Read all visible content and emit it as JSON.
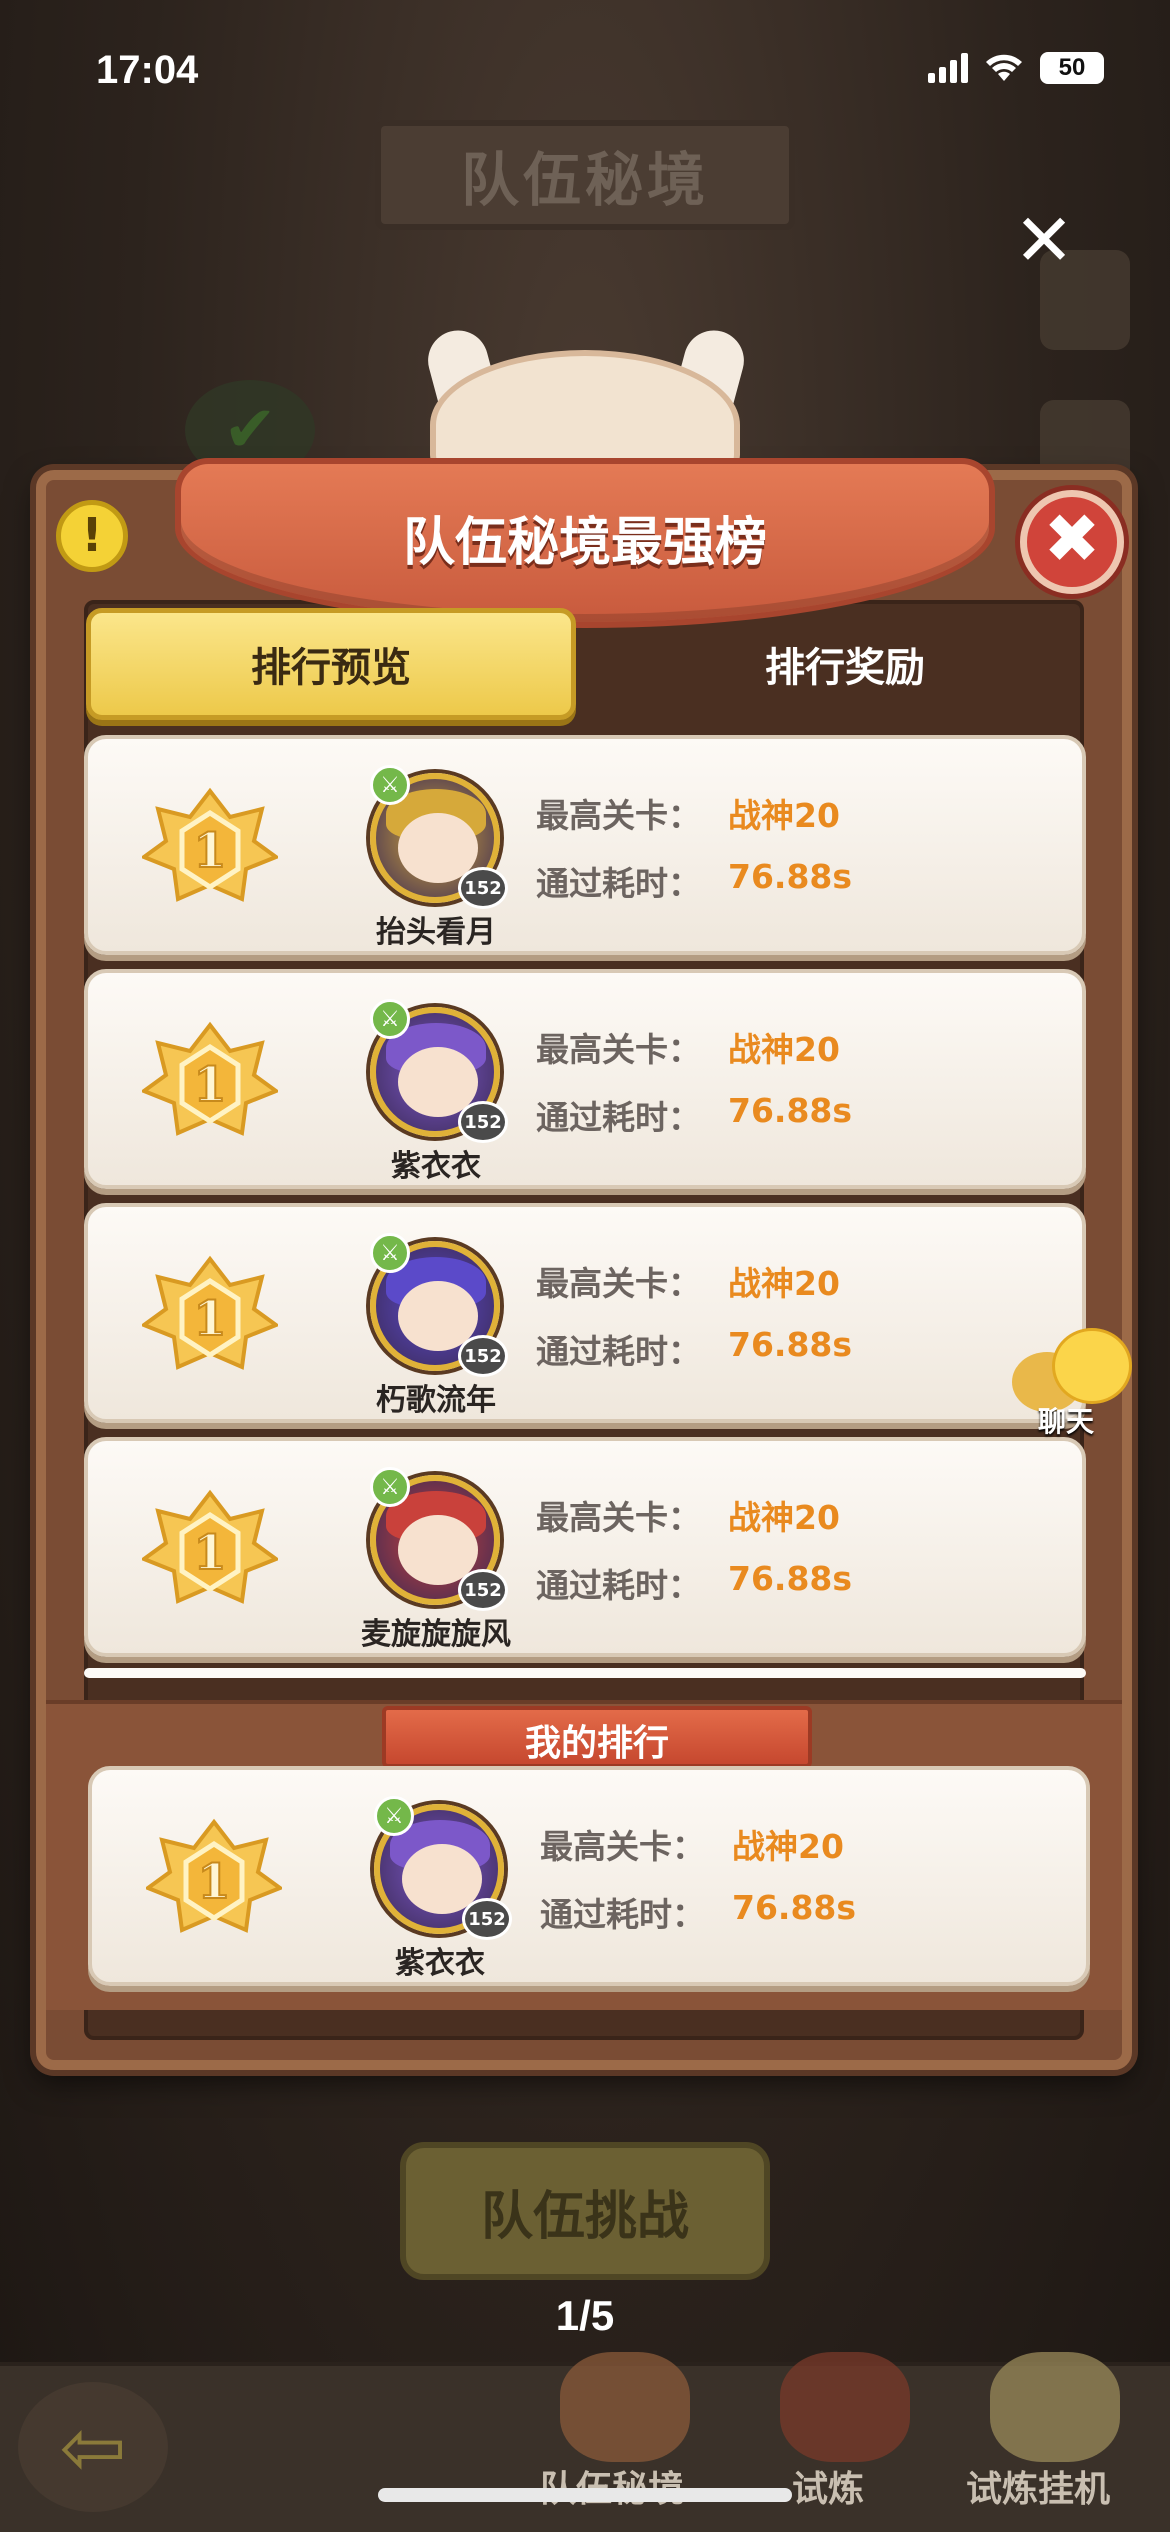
{
  "status_bar": {
    "time": "17:04",
    "battery": "50"
  },
  "background": {
    "banner_title": "队伍秘境",
    "challenge_button": "队伍挑战",
    "bottom_nav": [
      {
        "label": "队伍秘境"
      },
      {
        "label": "试炼"
      },
      {
        "label": "试炼挂机"
      }
    ]
  },
  "panel": {
    "title": "队伍秘境最强榜",
    "help_symbol": "!",
    "close_symbol": "✖",
    "tabs": [
      {
        "label": "排行预览",
        "active": true
      },
      {
        "label": "排行奖励",
        "active": false
      }
    ],
    "stat_labels": {
      "stage": "最高关卡：",
      "time": "通过耗时："
    },
    "rankings": [
      {
        "rank": "1",
        "name": "抬头看月",
        "level": "152",
        "stage": "战神20",
        "time": "76.88s",
        "avatar_color": "#d6a93a"
      },
      {
        "rank": "1",
        "name": "紫衣衣",
        "level": "152",
        "stage": "战神20",
        "time": "76.88s",
        "avatar_color": "#7c58c9"
      },
      {
        "rank": "1",
        "name": "朽歌流年",
        "level": "152",
        "stage": "战神20",
        "time": "76.88s",
        "avatar_color": "#5b4ac9"
      },
      {
        "rank": "1",
        "name": "麦旋旋旋风",
        "level": "152",
        "stage": "战神20",
        "time": "76.88s",
        "avatar_color": "#c9413b"
      }
    ],
    "my_rank": {
      "title": "我的排行",
      "rank": "1",
      "name": "紫衣衣",
      "level": "152",
      "stage": "战神20",
      "time": "76.88s",
      "avatar_color": "#7c58c9"
    }
  },
  "chat_label": "聊天",
  "overlay_close_symbol": "✕",
  "page_indicator": "1/5",
  "colors": {
    "accent_orange": "#e98a1f",
    "tab_active": "#f4d864",
    "panel_brown": "#7a4c34"
  }
}
